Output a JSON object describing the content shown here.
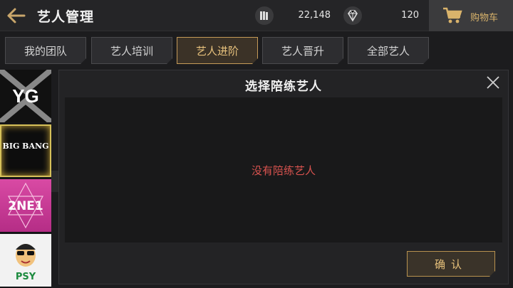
{
  "header": {
    "title": "艺人管理",
    "cards_value": "22,148",
    "gems_value": "120",
    "cart_label": "购物车"
  },
  "tabs": [
    {
      "label": "我的团队",
      "active": false
    },
    {
      "label": "艺人培训",
      "active": false
    },
    {
      "label": "艺人进阶",
      "active": true
    },
    {
      "label": "艺人晋升",
      "active": false
    },
    {
      "label": "全部艺人",
      "active": false
    }
  ],
  "sidebar": {
    "logos": [
      {
        "name": "YG",
        "label": ""
      },
      {
        "name": "BIGBANG",
        "label": "BIG BANG"
      },
      {
        "name": "2NE1",
        "label": "2NE1"
      },
      {
        "name": "PSY",
        "label": "PSY"
      }
    ]
  },
  "modal": {
    "title": "选择陪练艺人",
    "empty_text": "没有陪练艺人",
    "confirm_label": "确认"
  },
  "colors": {
    "accent_gold": "#c49a58",
    "empty_red": "#d9534f"
  }
}
